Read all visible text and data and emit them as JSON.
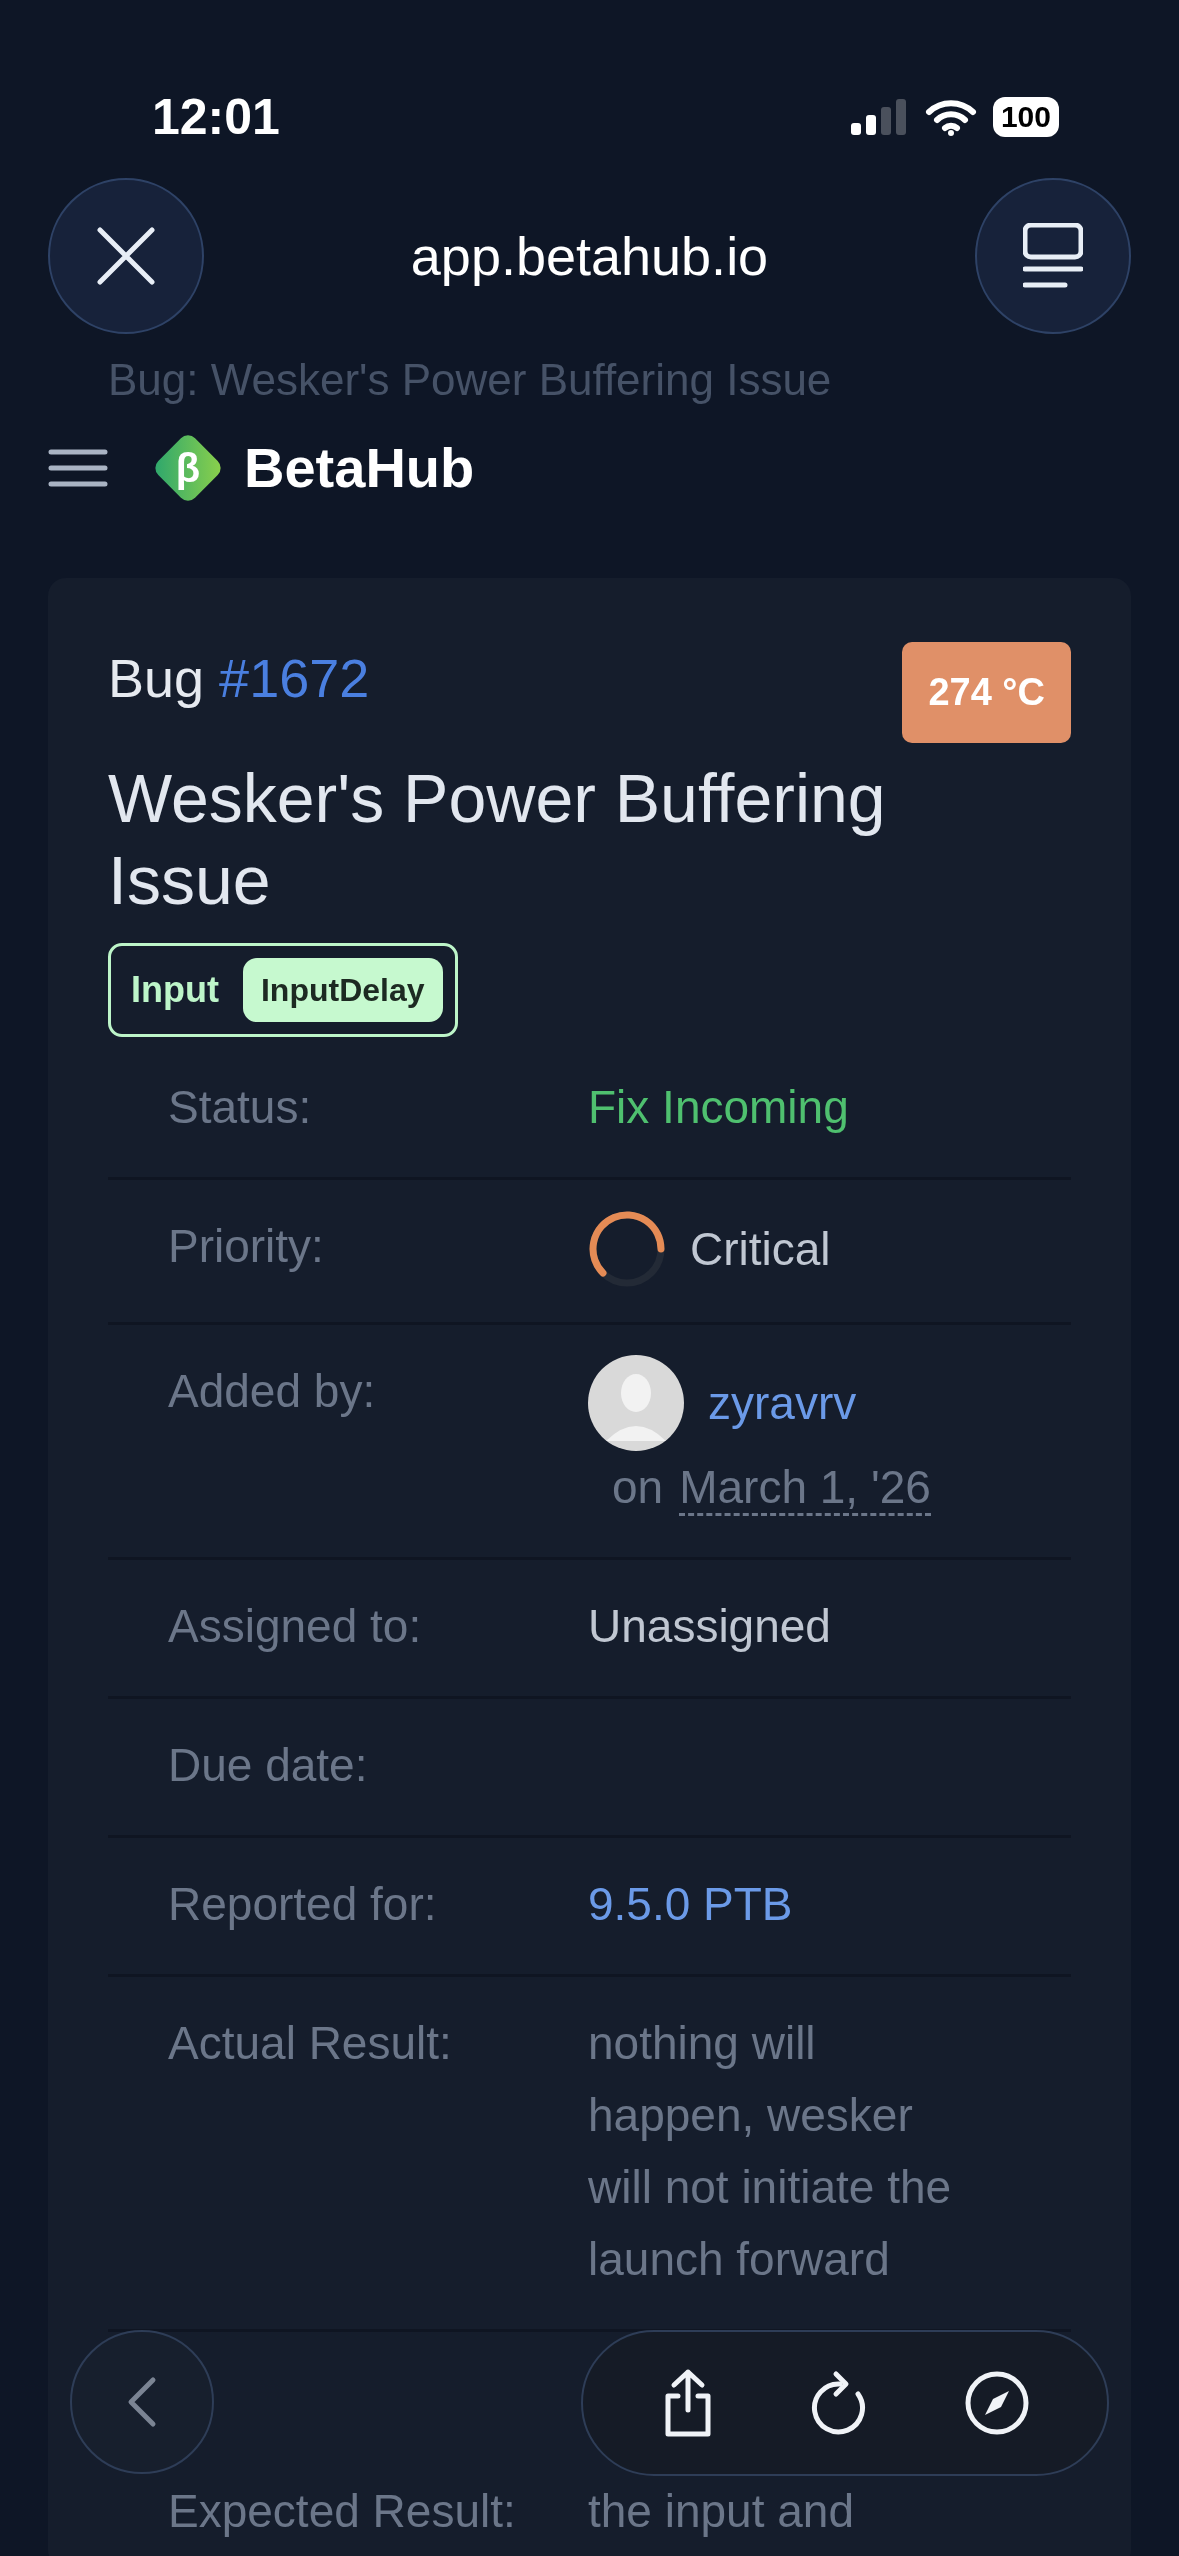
{
  "status_bar": {
    "time": "12:01",
    "battery": "100"
  },
  "browser_bar": {
    "url": "app.betahub.io"
  },
  "page_title_behind": "Bug: Wesker's Power Buffering Issue",
  "nav": {
    "logo_mark": "β",
    "brand": "BetaHub"
  },
  "bug": {
    "label": "Bug",
    "number": "#1672",
    "heat": "274 °C",
    "title": "Wesker's Power Buffering Issue",
    "tag": {
      "category": "Input",
      "name": "InputDelay"
    }
  },
  "fields": [
    {
      "kind": "status",
      "label": "Status:",
      "value": "Fix Incoming"
    },
    {
      "kind": "priority",
      "label": "Priority:",
      "value": "Critical"
    },
    {
      "kind": "user",
      "label": "Added by:",
      "value": "zyravrv",
      "prefix": "on",
      "date": "March 1, '26"
    },
    {
      "kind": "text",
      "label": "Assigned to:",
      "value": "Unassigned"
    },
    {
      "kind": "empty",
      "label": "Due date:"
    },
    {
      "kind": "link",
      "label": "Reported for:",
      "value": "9.5.0 PTB"
    },
    {
      "kind": "lines",
      "label": "Actual Result:",
      "lines": [
        "nothing will",
        "happen, wesker",
        "will not initiate the",
        "launch forward"
      ]
    },
    {
      "kind": "lines",
      "label": "Expected Result:",
      "lines": [
        "the input and"
      ]
    }
  ]
}
